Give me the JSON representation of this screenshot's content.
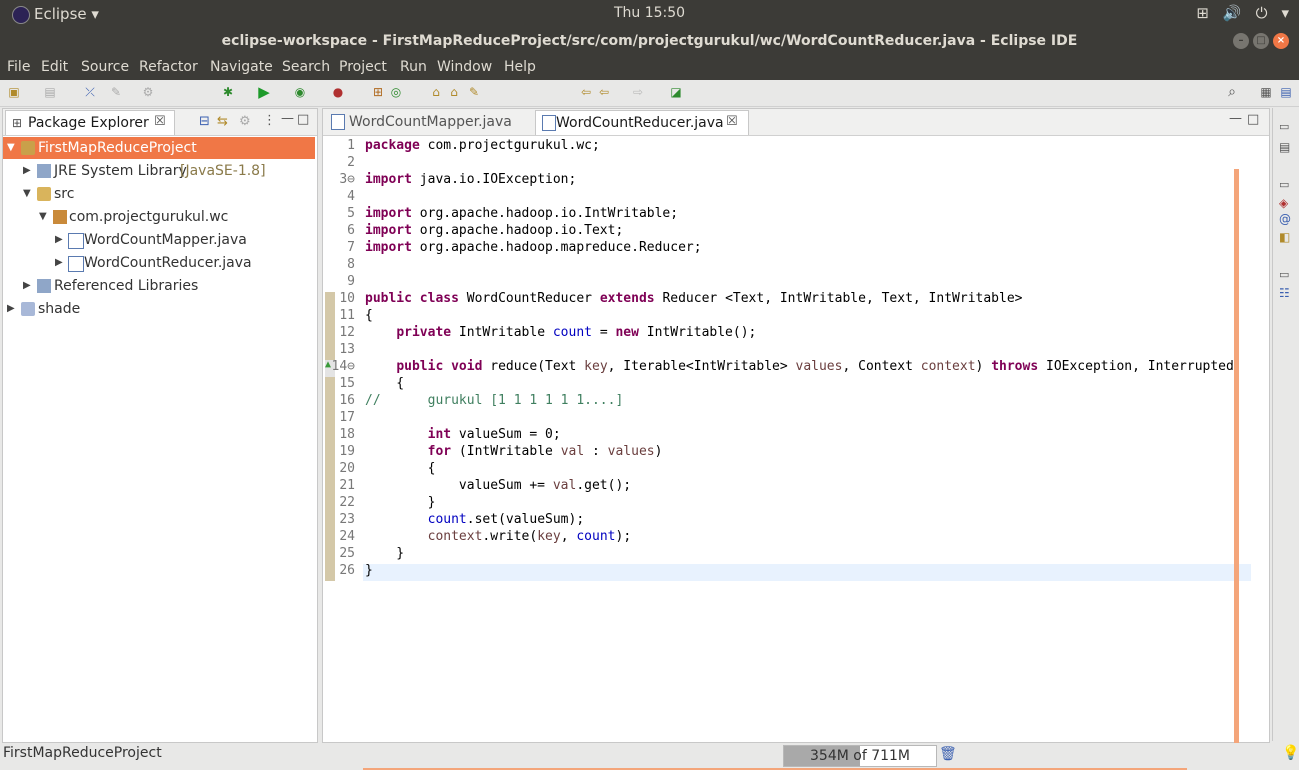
{
  "system_bar": {
    "app_label": "Eclipse ▾",
    "clock": "Thu 15:50"
  },
  "window": {
    "title": "eclipse-workspace - FirstMapReduceProject/src/com/projectgurukul/wc/WordCountReducer.java - Eclipse IDE"
  },
  "menu": [
    "File",
    "Edit",
    "Source",
    "Refactor",
    "Navigate",
    "Search",
    "Project",
    "Run",
    "Window",
    "Help"
  ],
  "package_explorer": {
    "tab_label": "Package Explorer",
    "tree": [
      {
        "label": "FirstMapReduceProject",
        "suffix": "",
        "level": 0,
        "expanded": true,
        "selected": true,
        "icon": "project-icon"
      },
      {
        "label": "JRE System Library",
        "suffix": " [JavaSE-1.8]",
        "level": 1,
        "expanded": false,
        "selected": false,
        "icon": "library-icon"
      },
      {
        "label": "src",
        "suffix": "",
        "level": 1,
        "expanded": true,
        "selected": false,
        "icon": "source-folder-icon"
      },
      {
        "label": "com.projectgurukul.wc",
        "suffix": "",
        "level": 2,
        "expanded": true,
        "selected": false,
        "icon": "package-icon"
      },
      {
        "label": "WordCountMapper.java",
        "suffix": "",
        "level": 3,
        "expanded": false,
        "selected": false,
        "icon": "java-file-icon"
      },
      {
        "label": "WordCountReducer.java",
        "suffix": "",
        "level": 3,
        "expanded": false,
        "selected": false,
        "icon": "java-file-icon"
      },
      {
        "label": "Referenced Libraries",
        "suffix": "",
        "level": 1,
        "expanded": false,
        "selected": false,
        "icon": "library-icon"
      },
      {
        "label": "shade",
        "suffix": "",
        "level": 0,
        "expanded": false,
        "selected": false,
        "icon": "folder-icon"
      }
    ]
  },
  "editor": {
    "tabs": [
      {
        "label": "WordCountMapper.java",
        "active": false
      },
      {
        "label": "WordCountReducer.java",
        "active": true
      }
    ],
    "lines": [
      "package com.projectgurukul.wc;",
      "",
      "import java.io.IOException;",
      "",
      "import org.apache.hadoop.io.IntWritable;",
      "import org.apache.hadoop.io.Text;",
      "import org.apache.hadoop.mapreduce.Reducer;",
      "",
      "",
      "public class WordCountReducer extends Reducer <Text, IntWritable, Text, IntWritable>",
      "{",
      "    private IntWritable count = new IntWritable();",
      "",
      "    public void reduce(Text key, Iterable<IntWritable> values, Context context) throws IOException, Interrupted",
      "    {",
      "//      gurukul [1 1 1 1 1 1....]",
      "",
      "        int valueSum = 0;",
      "        for (IntWritable val : values)",
      "        {",
      "            valueSum += val.get();",
      "        }",
      "        count.set(valueSum);",
      "        context.write(key, count);",
      "    }",
      "}"
    ]
  },
  "status_bar": {
    "selection": "FirstMapReduceProject",
    "heap_label": "354M of 711M",
    "heap_used_fraction": 0.498
  }
}
